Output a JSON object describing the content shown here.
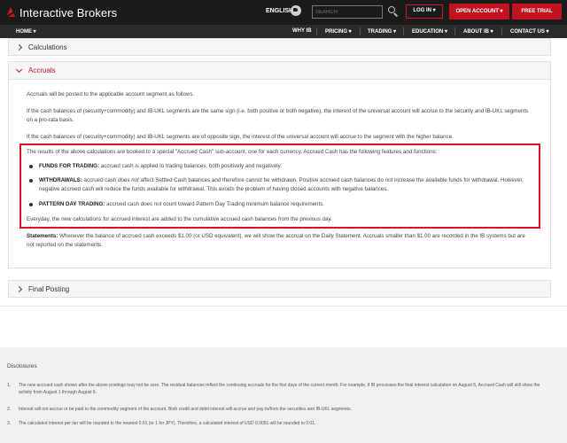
{
  "header": {
    "logo_text": "Interactive Brokers",
    "language": "ENGLISH",
    "search_placeholder": "SEARCH",
    "login_label": "LOG IN",
    "login_caret": "▾",
    "open_account_label": "OPEN ACCOUNT ▾",
    "free_trial_label": "FREE TRIAL",
    "brand_color": "#d81222"
  },
  "nav": {
    "home": "HOME ▾",
    "items": [
      "WHY IB",
      "PRICING ▾",
      "TRADING ▾",
      "EDUCATION ▾",
      "ABOUT IB ▾",
      "CONTACT US ▾"
    ]
  },
  "sections": {
    "calculations": "Calculations",
    "accruals": "Accruals",
    "final_posting": "Final Posting"
  },
  "accruals": {
    "p1": "Accruals will be posted to the applicable account segment as follows.",
    "p2": "If the cash balances of (security+commodity) and IB-UKL segments are the same sign (i.e. both positive or both negative), the interest of the universal account will accrue to the security and IB-UKL segments on a pro-rata basis.",
    "p3": "If the cash balances of (security+commodity) and IB-UKL segments are of opposite sign, the interest of the universal account will accrue to the segment with the higher balance.",
    "p4": "The results of the above calculations are booked to a special \"Accrued Cash\" sub-account, one for each currency. Accrued Cash has the following features and functions:",
    "b1_term": "FUNDS FOR TRADING:",
    "b1_a": " accrued cash ",
    "b1_em": "is",
    "b1_b": " applied to trading balances, both positively and negatively.",
    "b2_term": "WITHDRAWALS:",
    "b2_a": " accrued cash ",
    "b2_em": "does not",
    "b2_b": " affect Settled Cash balances and therefore cannot be withdrawn. Positive accrued cash balances do ",
    "b2_em2": "not",
    "b2_c": " increase the available funds for withdrawal. However, negative accrued cash will reduce the funds available for withdrawal. This avoids the problem of having closed accounts with negative balances.",
    "b3_term": "PATTERN DAY TRADING:",
    "b3_a": " accrued cash ",
    "b3_em": "does not",
    "b3_b": " count toward Pattern Day Trading minimum balance requirements.",
    "p5": "Everyday, the new calculations for accrued interest are added to the cumulative accrued cash balances from the previous day.",
    "statements_term": "Statements:",
    "statements_text": " Whenever the balance of accrued cash exceeds $1.00 (or USD equivalent), we will show the accrual on the Daily Statement. Accruals smaller than $1.00 are recorded in the IB systems but are not reported on the statements."
  },
  "disclosures": {
    "title": "Disclosures",
    "items": [
      {
        "num": "1.",
        "text": "The new accrued cash shown after the above postings may not be zero. The residual balances reflect the continuing accruals for the first days of the current month. For example, if IB processes the final interest calculation on August 6, Accrued Cash will still show the activity from August 1 through August 6."
      },
      {
        "num": "2.",
        "text": "Interest will not accrue or be paid to the commodity segment of the account. Both credit and debit interest will accrue and pay to/from the securities and IB-UKL segments."
      },
      {
        "num": "3.",
        "text": "The calculated interest per tier will be rounded to the nearest 0.01 (or 1 for JPY). Therefore, a calculated interest of USD 0.0051 will be rounded to 0.01."
      }
    ]
  }
}
